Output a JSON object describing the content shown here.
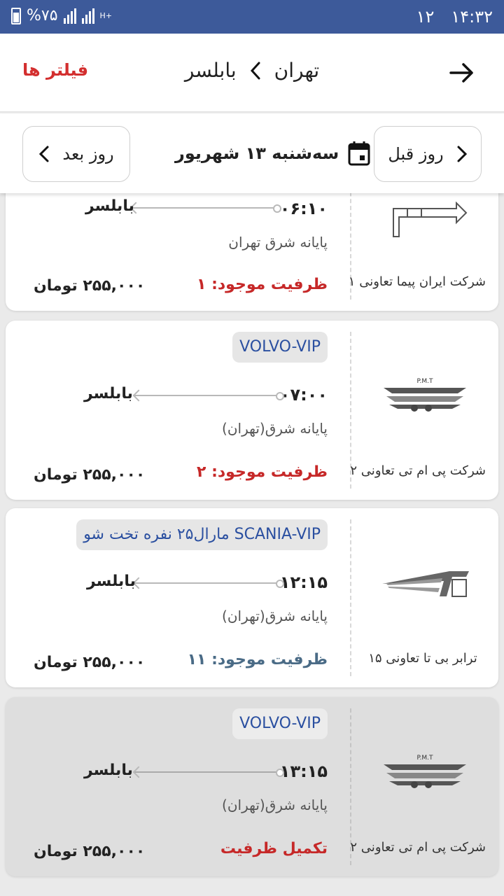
{
  "status_bar": {
    "battery": "%۷۵",
    "network": "H+",
    "time": "۱۴:۳۲",
    "notification_count": "۱۲"
  },
  "header": {
    "origin": "تهران",
    "destination": "بابلسر",
    "filters_label": "فیلتر ها"
  },
  "date_bar": {
    "prev_day_label": "روز قبل",
    "next_day_label": "روز بعد",
    "current_date": "سه‌شنبه ۱۳ شهریور"
  },
  "trips": [
    {
      "company": "شرکت ایران پیما تعاونی ۱",
      "time": "۰۶:۱۰",
      "destination": "بابلسر",
      "terminal": "پایانه شرق تهران",
      "capacity": "ظرفیت موجود: ۱",
      "price": "۲۵۵,۰۰۰ تومان",
      "capacity_color": "#c62828"
    },
    {
      "company": "شرکت پی ام تی تعاونی ۲",
      "bus_type": "VOLVO-VIP",
      "time": "۰۷:۰۰",
      "destination": "بابلسر",
      "terminal": "پایانه شرق(تهران)",
      "capacity": "ظرفیت موجود: ۲",
      "price": "۲۵۵,۰۰۰ تومان",
      "capacity_color": "#c62828"
    },
    {
      "company": "ترابر بی تا تعاونی ۱۵",
      "bus_type": "SCANIA-VIP مارال۲۵ نفره تخت شو",
      "time": "۱۲:۱۵",
      "destination": "بابلسر",
      "terminal": "پایانه شرق(تهران)",
      "capacity": "ظرفیت موجود: ۱۱",
      "price": "۲۵۵,۰۰۰ تومان",
      "capacity_color": "#4a6b86"
    },
    {
      "company": "شرکت پی ام تی تعاونی ۲",
      "bus_type": "VOLVO-VIP",
      "time": "۱۳:۱۵",
      "destination": "بابلسر",
      "terminal": "پایانه شرق(تهران)",
      "capacity": "تکمیل ظرفیت",
      "price": "۲۵۵,۰۰۰ تومان",
      "capacity_color": "#c62828"
    }
  ],
  "logos": {
    "pmt_text": "P.M.T"
  }
}
